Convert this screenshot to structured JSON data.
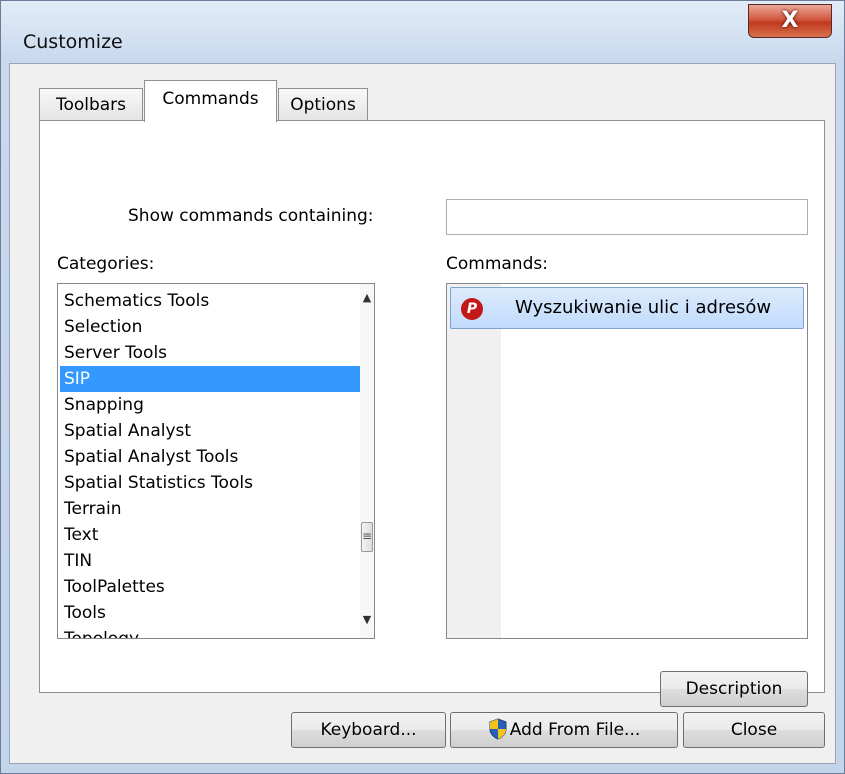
{
  "window": {
    "title": "Customize",
    "close_glyph": "X"
  },
  "tabs": [
    {
      "label": "Toolbars",
      "active": false
    },
    {
      "label": "Commands",
      "active": true
    },
    {
      "label": "Options",
      "active": false
    }
  ],
  "search": {
    "label": "Show commands containing:",
    "value": ""
  },
  "categories": {
    "label": "Categories:",
    "items": [
      "Schematics Tools",
      "Selection",
      "Server Tools",
      "SIP",
      "Snapping",
      "Spatial Analyst",
      "Spatial Analyst Tools",
      "Spatial Statistics Tools",
      "Terrain",
      "Text",
      "TIN",
      "ToolPalettes",
      "Tools",
      "Topology"
    ],
    "selected": "SIP"
  },
  "commands": {
    "label": "Commands:",
    "items": [
      {
        "label": "Wyszukiwanie ulic i adresów",
        "icon": "red-pushpin-icon",
        "selected": true
      }
    ]
  },
  "buttons": {
    "description": "Description",
    "keyboard": "Keyboard...",
    "add_from_file": "Add From File...",
    "close": "Close"
  },
  "colors": {
    "selection": "#3399ff",
    "command_highlight": "#c1dbfc",
    "close_button": "#c13a1f"
  }
}
